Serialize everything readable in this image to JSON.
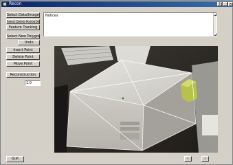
{
  "window": {
    "title": "Recon",
    "controls": [
      "?",
      "_",
      "×"
    ]
  },
  "toolbar": {
    "select_data_image": "Select Data(Image)",
    "select_delete_points": "Select Delete Points(Only)",
    "feature_tracking": "Feature Tracking",
    "select_new_polygon": "Select New Polygon",
    "undo": "Undo",
    "insert_point": "Insert Point",
    "delete_point": "Delete Point",
    "move_point": "Move Point",
    "reconstruction": "Reconstruction",
    "zoom_value": "1.0",
    "quit": "Quit"
  },
  "notices": {
    "label": "Notices"
  },
  "nav": {
    "prev": "<",
    "next": ">"
  },
  "colors": {
    "titlebar": "#0a246a",
    "face": "#d4d0c8",
    "overlay_lines": "#ffffff"
  }
}
